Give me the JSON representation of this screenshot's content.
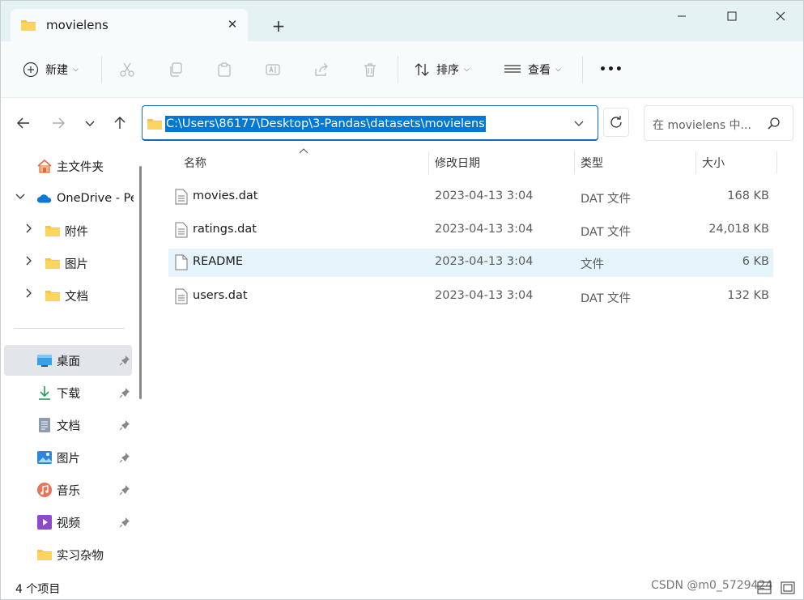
{
  "window": {
    "tab_title": "movielens",
    "new_tab": "+",
    "close_tab": "✕"
  },
  "toolbar": {
    "new_label": "新建",
    "sort_label": "排序",
    "view_label": "查看",
    "more_label": "•••"
  },
  "address": {
    "path": "C:\\Users\\86177\\Desktop\\3-Pandas\\datasets\\movielens"
  },
  "search": {
    "placeholder": "在 movielens 中..."
  },
  "sidebar": {
    "home": "主文件夹",
    "onedrive": "OneDrive - Pe",
    "od_items": [
      "附件",
      "图片",
      "文档"
    ],
    "quick": [
      "桌面",
      "下载",
      "文档",
      "图片",
      "音乐",
      "视频",
      "实习杂物"
    ]
  },
  "columns": {
    "name": "名称",
    "modified": "修改日期",
    "type": "类型",
    "size": "大小"
  },
  "files": [
    {
      "name": "movies.dat",
      "modified": "2023-04-13 3:04",
      "type": "DAT 文件",
      "size": "168 KB"
    },
    {
      "name": "ratings.dat",
      "modified": "2023-04-13 3:04",
      "type": "DAT 文件",
      "size": "24,018 KB"
    },
    {
      "name": "README",
      "modified": "2023-04-13 3:04",
      "type": "文件",
      "size": "6 KB"
    },
    {
      "name": "users.dat",
      "modified": "2023-04-13 3:04",
      "type": "DAT 文件",
      "size": "132 KB"
    }
  ],
  "status": {
    "count": "4 个项目",
    "watermark": "CSDN @m0_5729424"
  },
  "colors": {
    "accent": "#0078d4",
    "titlebar": "#e4f2f4",
    "selection": "#e5f3fb",
    "folder": "#f9c642"
  }
}
